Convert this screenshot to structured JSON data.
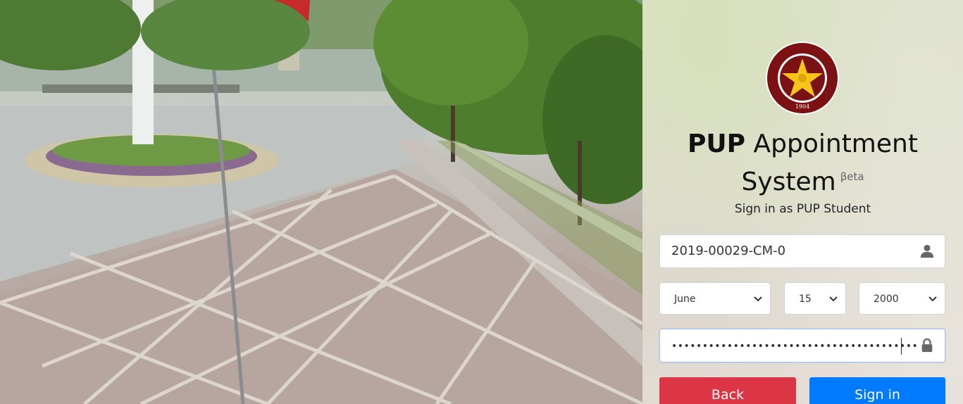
{
  "background": {
    "scene": "campus-plaza-photo",
    "icon": "campus-photo"
  },
  "logo": {
    "text": "POLYTECHNIC UNIVERSITY OF THE PHILIPPINES",
    "year": "1904",
    "colors": {
      "maroon": "#7b1113",
      "gold": "#f5c518"
    }
  },
  "header": {
    "title_bold": "PUP",
    "title_rest": "Appointment",
    "title_line2": "System",
    "beta": "βeta",
    "subtitle": "Sign in as PUP Student"
  },
  "form": {
    "student_number": "2019-00029-CM-0",
    "birth_month": "June",
    "birth_day": "15",
    "birth_year": "2000",
    "password_mask": "••••••••••••••••••••••••••••••••••••••••"
  },
  "buttons": {
    "back": "Back",
    "sign_in": "Sign in",
    "colors": {
      "back": "#dc3545",
      "sign_in": "#007bff"
    }
  },
  "icons": {
    "user": "user-icon",
    "lock": "lock-icon",
    "chevron": "chevron-down-icon"
  }
}
